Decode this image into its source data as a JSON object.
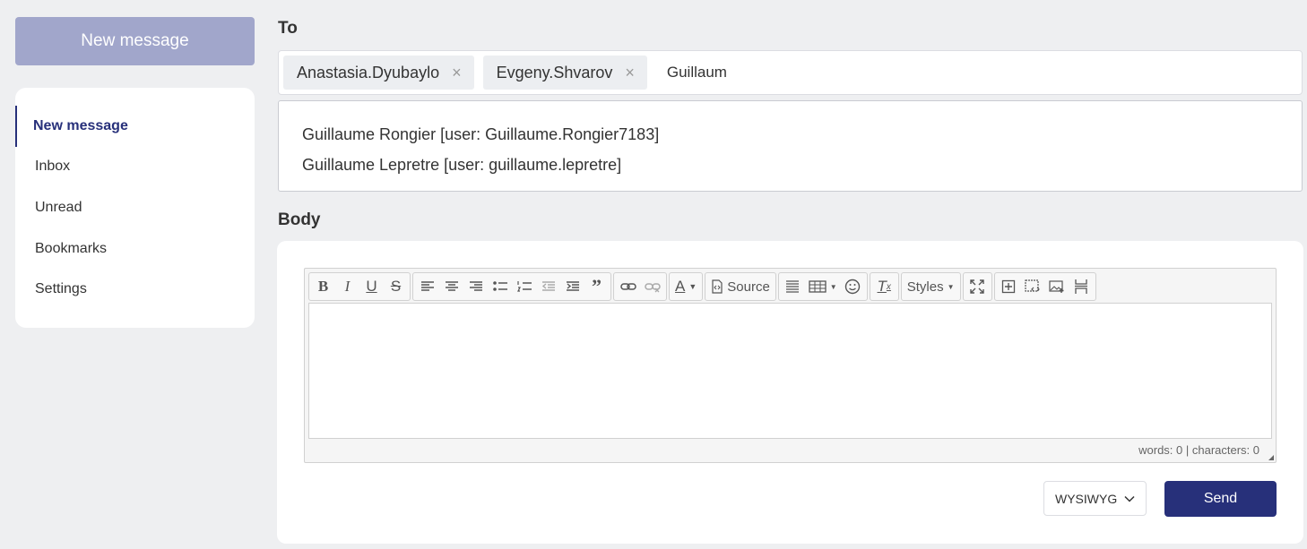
{
  "sidebar": {
    "new_message_button": "New message",
    "items": [
      {
        "label": "New message",
        "active": true
      },
      {
        "label": "Inbox"
      },
      {
        "label": "Unread"
      },
      {
        "label": "Bookmarks"
      },
      {
        "label": "Settings"
      }
    ]
  },
  "compose": {
    "to_label": "To",
    "recipients": [
      "Anastasia.Dyubaylo",
      "Evgeny.Shvarov"
    ],
    "remove_glyph": "×",
    "to_input_value": "Guillaum",
    "suggestions": [
      "Guillaume Rongier [user: Guillaume.Rongier7183]",
      "Guillaume Lepretre [user: guillaume.lepretre]"
    ],
    "body_label": "Body"
  },
  "editor": {
    "source_label": "Source",
    "styles_label": "Styles",
    "counter": "words: 0 | characters: 0"
  },
  "footer": {
    "mode_value": "WYSIWYG",
    "send_label": "Send"
  },
  "colors": {
    "accent": "#27307a",
    "new_message_button_bg": "#a1a6cb",
    "page_bg": "#eeeff1"
  }
}
